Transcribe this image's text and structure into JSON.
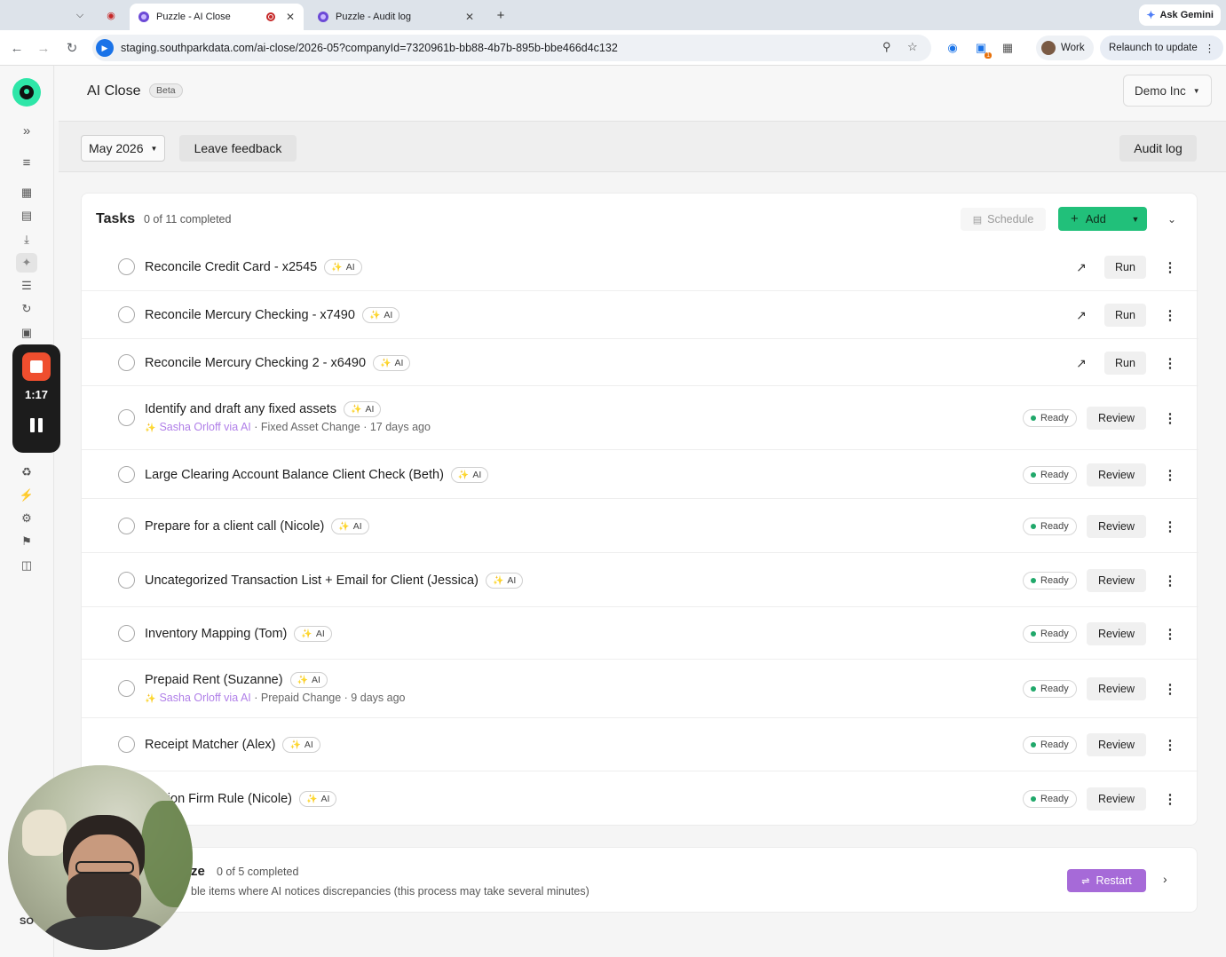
{
  "browser": {
    "tabs": [
      {
        "title": "Puzzle - AI Close",
        "active": true
      },
      {
        "title": "Puzzle - Audit log",
        "active": false
      }
    ],
    "new_tab_label": "+",
    "ask_gemini": "Ask Gemini",
    "url": "staging.southparkdata.com/ai-close/2026-05?companyId=7320961b-bb88-4b7b-895b-bbe466d4c132",
    "profile": "Work",
    "relaunch": "Relaunch to update",
    "extension_badge": "1"
  },
  "sidebar": {
    "recorder": {
      "time": "1:17"
    },
    "user_initials": "SO",
    "icons": [
      "expand-icon",
      "menu-icon",
      "dashboard-icon",
      "inbox-icon",
      "download-icon",
      "ai-sparkle-icon",
      "checklist-icon",
      "sync-icon",
      "reports-icon",
      "integrations-icon",
      "plug-icon",
      "settings-icon",
      "tag-icon",
      "gift-icon"
    ]
  },
  "header": {
    "title": "AI Close",
    "badge": "Beta",
    "company": "Demo Inc"
  },
  "toolbar": {
    "month": "May 2026",
    "feedback": "Leave feedback",
    "audit_log": "Audit log"
  },
  "tasks": {
    "title": "Tasks",
    "count": "0 of 11 completed",
    "schedule": "Schedule",
    "add": "Add",
    "ai_label": "AI",
    "run_label": "Run",
    "review_label": "Review",
    "ready_label": "Ready",
    "items": [
      {
        "name": "Reconcile Credit Card - x2545",
        "action": "Run"
      },
      {
        "name": "Reconcile Mercury Checking - x7490",
        "action": "Run"
      },
      {
        "name": "Reconcile Mercury Checking 2 - x6490",
        "action": "Run"
      },
      {
        "name": "Identify and draft any fixed assets",
        "action": "Review",
        "who": "Sasha Orloff via AI",
        "meta": " · Fixed Asset Change · 17 days ago"
      },
      {
        "name": "Large Clearing Account Balance Client Check (Beth)",
        "action": "Review"
      },
      {
        "name": "Prepare for a client call (Nicole)",
        "action": "Review"
      },
      {
        "name": "Uncategorized Transaction List + Email for Client (Jessica)",
        "action": "Review"
      },
      {
        "name": "Inventory Mapping (Tom)",
        "action": "Review"
      },
      {
        "name": "Prepaid Rent (Suzanne)",
        "action": "Review",
        "who": "Sasha Orloff via AI",
        "meta": " · Prepaid Change · 9 days ago"
      },
      {
        "name": "Receipt Matcher (Alex)",
        "action": "Review"
      },
      {
        "name": "Station Firm Rule (Nicole)",
        "action": "Review"
      }
    ]
  },
  "section2": {
    "title": "ze",
    "count": "0 of 5 completed",
    "description": "ble items where AI notices discrepancies (this process may take several minutes)",
    "restart": "Restart"
  },
  "colors": {
    "accent_green": "#21c07a",
    "restart_purple": "#a66ad8",
    "ai_attribution": "#b07fe8",
    "ready_dot": "#20a86a",
    "recorder_red": "#ef4e2e"
  }
}
